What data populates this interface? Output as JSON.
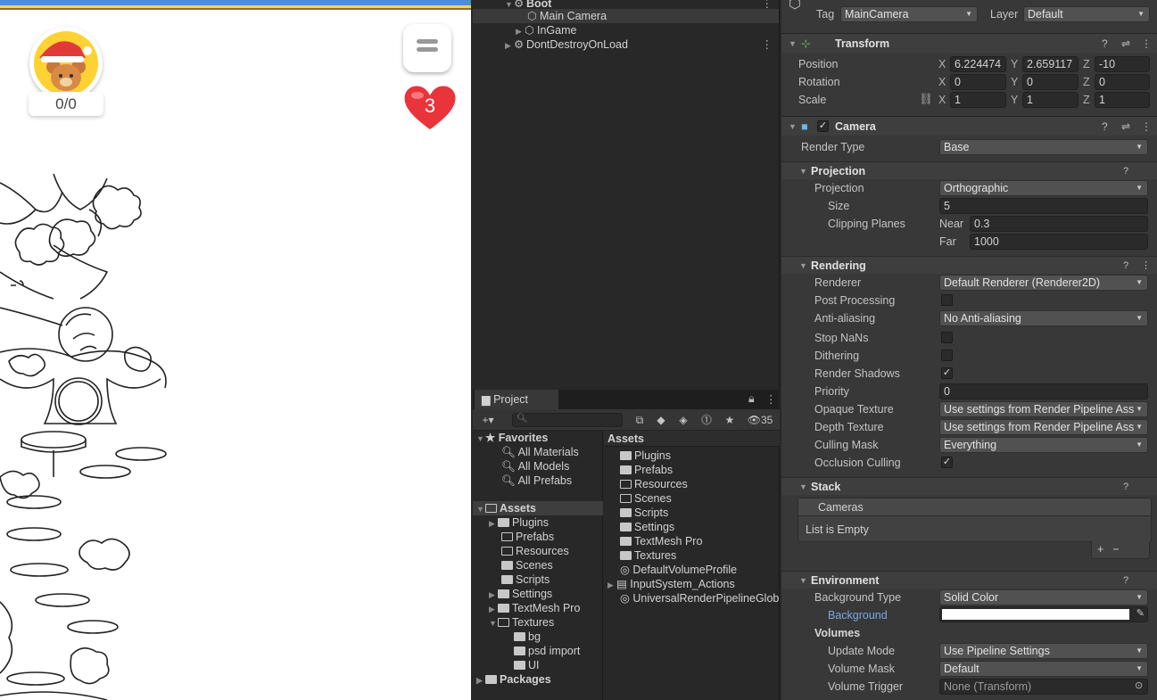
{
  "game": {
    "score": "0/0",
    "lives": "3"
  },
  "hierarchy": {
    "items": [
      {
        "label": "Boot"
      },
      {
        "label": "Main Camera"
      },
      {
        "label": "InGame"
      },
      {
        "label": "DontDestroyOnLoad"
      }
    ]
  },
  "project": {
    "tab_label": "Project",
    "hidden_count": "35",
    "favorites_label": "Favorites",
    "favorites": [
      "All Materials",
      "All Models",
      "All Prefabs"
    ],
    "tree": {
      "assets": "Assets",
      "folders": [
        "Plugins",
        "Prefabs",
        "Resources",
        "Scenes",
        "Scripts",
        "Settings",
        "TextMesh Pro",
        "Textures"
      ],
      "texture_children": [
        "bg",
        "psd import",
        "UI"
      ],
      "packages": "Packages"
    },
    "list_header": "Assets",
    "list": [
      "Plugins",
      "Prefabs",
      "Resources",
      "Scenes",
      "Scripts",
      "Settings",
      "TextMesh Pro",
      "Textures",
      "DefaultVolumeProfile",
      "InputSystem_Actions",
      "UniversalRenderPipelineGlob"
    ]
  },
  "inspector": {
    "tag_label": "Tag",
    "tag_value": "MainCamera",
    "layer_label": "Layer",
    "layer_value": "Default",
    "transform": {
      "title": "Transform",
      "position_label": "Position",
      "rotation_label": "Rotation",
      "scale_label": "Scale",
      "position": [
        "6.224474",
        "2.659117",
        "-10"
      ],
      "rotation": [
        "0",
        "0",
        "0"
      ],
      "scale": [
        "1",
        "1",
        "1"
      ],
      "axis_x": "X",
      "axis_y": "Y",
      "axis_z": "Z"
    },
    "camera": {
      "title": "Camera",
      "render_type_label": "Render Type",
      "render_type": "Base",
      "projection_section": "Projection",
      "projection_label": "Projection",
      "projection": "Orthographic",
      "size_label": "Size",
      "size": "5",
      "clipping_label": "Clipping Planes",
      "near_label": "Near",
      "near": "0.3",
      "far_label": "Far",
      "far": "1000",
      "rendering_section": "Rendering",
      "renderer_label": "Renderer",
      "renderer": "Default Renderer (Renderer2D)",
      "post_processing_label": "Post Processing",
      "anti_aliasing_label": "Anti-aliasing",
      "anti_aliasing": "No Anti-aliasing",
      "stop_nans_label": "Stop NaNs",
      "dithering_label": "Dithering",
      "render_shadows_label": "Render Shadows",
      "priority_label": "Priority",
      "priority": "0",
      "opaque_texture_label": "Opaque Texture",
      "opaque_texture": "Use settings from Render Pipeline Ass",
      "depth_texture_label": "Depth Texture",
      "depth_texture": "Use settings from Render Pipeline Ass",
      "culling_mask_label": "Culling Mask",
      "culling_mask": "Everything",
      "occlusion_culling_label": "Occlusion Culling",
      "stack_section": "Stack",
      "cameras_label": "Cameras",
      "list_empty": "List is Empty",
      "environment_section": "Environment",
      "background_type_label": "Background Type",
      "background_type": "Solid Color",
      "background_label": "Background",
      "background_color": "#ffffff",
      "volumes_label": "Volumes",
      "update_mode_label": "Update Mode",
      "update_mode": "Use Pipeline Settings",
      "volume_mask_label": "Volume Mask",
      "volume_mask": "Default",
      "volume_trigger_label": "Volume Trigger",
      "volume_trigger": "None (Transform)"
    }
  }
}
